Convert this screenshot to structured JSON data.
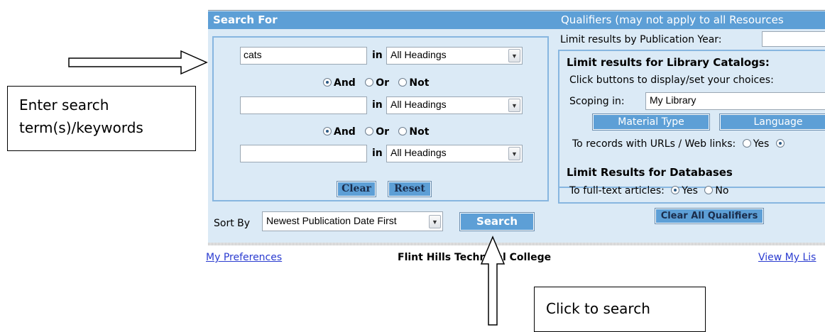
{
  "header": {
    "left_title": "Search For",
    "right_title": "Qualifiers (may not apply to all Resources"
  },
  "search_rows": [
    {
      "term": "cats",
      "in_label": "in",
      "field": "All Headings"
    },
    {
      "term": "",
      "in_label": "in",
      "field": "All Headings"
    },
    {
      "term": "",
      "in_label": "in",
      "field": "All Headings"
    }
  ],
  "operators": {
    "and": "And",
    "or": "Or",
    "not": "Not"
  },
  "buttons": {
    "clear": "Clear",
    "reset": "Reset",
    "search": "Search",
    "clear_all": "Clear All Qualifiers"
  },
  "sort": {
    "label": "Sort By",
    "value": "Newest Publication Date First"
  },
  "qualifiers": {
    "pub_year_label": "Limit results by Publication Year:",
    "catalogs_title": "Limit results for Library Catalogs:",
    "catalogs_hint": "Click buttons to display/set your choices:",
    "scoping_label": "Scoping in:",
    "scoping_value": "My Library",
    "material_type": "Material Type",
    "language": "Language",
    "urls_label": "To records with URLs / Web links:",
    "urls_yes": "Yes",
    "db_title": "Limit Results for Databases",
    "fulltext_label": "To full-text articles:",
    "fulltext_yes": "Yes",
    "fulltext_no": "No"
  },
  "footer": {
    "preferences": "My Preferences",
    "college": "Flint Hills Technical College",
    "view_list": "View My Lis"
  },
  "callouts": {
    "enter": "Enter search term(s)/keywords",
    "click": "Click to search"
  }
}
